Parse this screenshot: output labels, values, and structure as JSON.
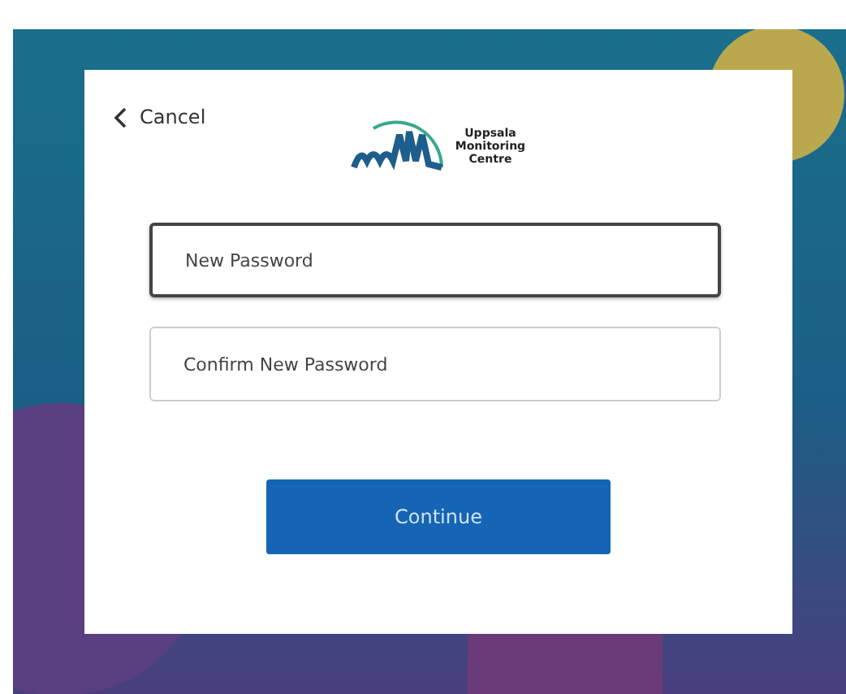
{
  "cancel": {
    "label": "Cancel"
  },
  "logo": {
    "lines": [
      "Uppsala",
      "Monitoring",
      "Centre"
    ]
  },
  "fields": [
    {
      "placeholder": "New Password",
      "focused": true
    },
    {
      "placeholder": "Confirm New Password",
      "focused": false
    }
  ],
  "continue_button": {
    "label": "Continue"
  }
}
